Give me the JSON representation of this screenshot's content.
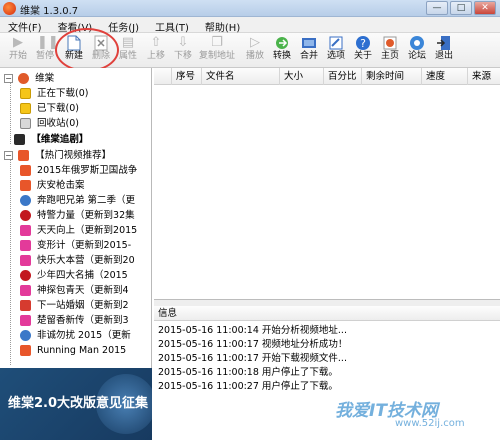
{
  "window": {
    "title": "维棠 1.3.0.7"
  },
  "menu": [
    "文件(F)",
    "查看(V)",
    "任务(J)",
    "工具(T)",
    "帮助(H)"
  ],
  "toolbar": {
    "items": [
      {
        "label": "开始",
        "icon": "play-icon",
        "enabled": false
      },
      {
        "label": "暂停",
        "icon": "pause-icon",
        "enabled": false
      },
      {
        "label": "新建",
        "icon": "new-file-icon",
        "enabled": true
      },
      {
        "label": "删除",
        "icon": "delete-icon",
        "enabled": false
      },
      {
        "label": "属性",
        "icon": "properties-icon",
        "enabled": false
      },
      {
        "label": "上移",
        "icon": "move-up-icon",
        "enabled": false
      },
      {
        "label": "下移",
        "icon": "move-down-icon",
        "enabled": false
      },
      {
        "label": "复制地址",
        "icon": "copy-address-icon",
        "enabled": false
      },
      {
        "label": "播放",
        "icon": "video-play-icon",
        "enabled": false
      },
      {
        "label": "转换",
        "icon": "convert-icon",
        "enabled": true
      },
      {
        "label": "合并",
        "icon": "merge-icon",
        "enabled": true
      },
      {
        "label": "选项",
        "icon": "options-icon",
        "enabled": true
      },
      {
        "label": "关于",
        "icon": "about-icon",
        "enabled": true
      },
      {
        "label": "主页",
        "icon": "home-icon",
        "enabled": true
      },
      {
        "label": "论坛",
        "icon": "forum-icon",
        "enabled": true
      },
      {
        "label": "退出",
        "icon": "exit-icon",
        "enabled": true
      }
    ]
  },
  "sidebar": {
    "root": "维棠",
    "folders": [
      {
        "label": "正在下载(0)",
        "color": "#f5c518"
      },
      {
        "label": "已下载(0)",
        "color": "#f5c518"
      },
      {
        "label": "回收站(0)",
        "icon": "trash-icon"
      }
    ],
    "special": "【维棠追剧】",
    "hot_label": "【热门视频推荐】",
    "videos": [
      {
        "label": "2015年俄罗斯卫国战争",
        "color": "#e8562a"
      },
      {
        "label": "庆安枪击案",
        "color": "#e8562a"
      },
      {
        "label": "奔跑吧兄弟 第二季（更",
        "color": "#3b78c8"
      },
      {
        "label": "特警力量（更新到32集",
        "color": "#c2181f"
      },
      {
        "label": "天天向上（更新到2015",
        "color": "#e33a9a"
      },
      {
        "label": "变形计（更新到2015-",
        "color": "#e33a9a"
      },
      {
        "label": "快乐大本营（更新到20",
        "color": "#e33a9a"
      },
      {
        "label": "少年四大名捕（2015",
        "color": "#c2181f"
      },
      {
        "label": "神探包青天（更新到4",
        "color": "#e33a9a"
      },
      {
        "label": "下一站婚姻（更新到2",
        "color": "#d63b2f"
      },
      {
        "label": "楚留香新传（更新到3",
        "color": "#e33a9a"
      },
      {
        "label": "非诚勿扰 2015（更新",
        "color": "#3b78c8"
      },
      {
        "label": "Running Man 2015",
        "color": "#e8562a"
      }
    ]
  },
  "banner": {
    "text": "维棠2.0大改版意见征集"
  },
  "list": {
    "columns": [
      "序号",
      "文件名",
      "大小",
      "百分比",
      "剩余时间",
      "速度",
      "来源"
    ]
  },
  "info": {
    "header": "信息",
    "lines": [
      "2015-05-16 11:00:14 开始分析视频地址...",
      "2015-05-16 11:00:17 视频地址分析成功！",
      "2015-05-16 11:00:17 开始下载视频文件...",
      "2015-05-16 11:00:18 用户停止了下载。",
      "2015-05-16 11:00:27 用户停止了下载。"
    ]
  },
  "watermark": {
    "main": "我爱IT技术网",
    "sub": "www.52ij.com"
  },
  "colors": {
    "accent": "#e0413c",
    "titlebar": "#c4d7ee",
    "banner": "#1f4e79"
  }
}
